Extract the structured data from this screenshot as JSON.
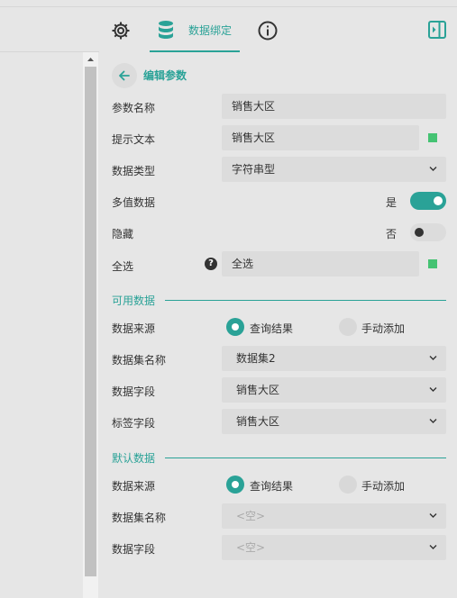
{
  "tabs": {
    "bind_label": "数据绑定"
  },
  "header": {
    "title": "编辑参数"
  },
  "form": {
    "param_name": {
      "label": "参数名称",
      "value": "销售大区"
    },
    "prompt_text": {
      "label": "提示文本",
      "value": "销售大区"
    },
    "data_type": {
      "label": "数据类型",
      "value": "字符串型"
    },
    "multi_value": {
      "label": "多值数据",
      "state_label": "是"
    },
    "hidden": {
      "label": "隐藏",
      "state_label": "否"
    },
    "select_all": {
      "label": "全选",
      "help": "?",
      "value": "全选"
    }
  },
  "available_data": {
    "title": "可用数据",
    "source": {
      "label": "数据来源",
      "option_query": "查询结果",
      "option_manual": "手动添加"
    },
    "dataset": {
      "label": "数据集名称",
      "value": "数据集2"
    },
    "data_field": {
      "label": "数据字段",
      "value": "销售大区"
    },
    "label_field": {
      "label": "标签字段",
      "value": "销售大区"
    }
  },
  "default_data": {
    "title": "默认数据",
    "source": {
      "label": "数据来源",
      "option_query": "查询结果",
      "option_manual": "手动添加"
    },
    "dataset": {
      "label": "数据集名称",
      "value": "<空>"
    },
    "data_field": {
      "label": "数据字段",
      "value": "<空>"
    }
  },
  "colors": {
    "accent": "#2aa297",
    "indicator": "#45c373",
    "field_bg": "#dcdcdc",
    "panel_bg": "#e6e6e6"
  },
  "icons": [
    "gear-icon",
    "database-icon",
    "info-icon",
    "panel-toggle-icon",
    "arrow-left-icon",
    "chevron-down-icon",
    "scroll-up-icon"
  ]
}
